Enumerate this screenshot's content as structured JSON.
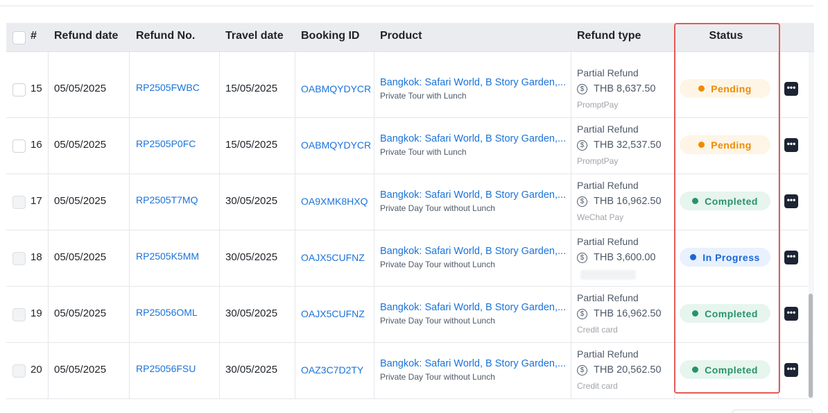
{
  "table": {
    "columns": {
      "index": "#",
      "refund_date": "Refund date",
      "refund_no": "Refund No.",
      "travel_date": "Travel date",
      "booking_id": "Booking ID",
      "product": "Product",
      "refund_type": "Refund type",
      "status": "Status"
    },
    "rows": [
      {
        "index": "15",
        "refund_date": "05/05/2025",
        "refund_no": "RP2505FWBC",
        "travel_date": "15/05/2025",
        "booking_id": "OABMQYDYCR",
        "product_title": "Bangkok: Safari World, B Story Garden,...",
        "product_sub": "Private Tour with Lunch",
        "refund_type": "Partial Refund",
        "amount": "THB 8,637.50",
        "payment": "PromptPay",
        "status": "Pending",
        "status_kind": "pending",
        "checkbox_disabled": false
      },
      {
        "index": "16",
        "refund_date": "05/05/2025",
        "refund_no": "RP2505P0FC",
        "travel_date": "15/05/2025",
        "booking_id": "OABMQYDYCR",
        "product_title": "Bangkok: Safari World, B Story Garden,...",
        "product_sub": "Private Tour with Lunch",
        "refund_type": "Partial Refund",
        "amount": "THB 32,537.50",
        "payment": "PromptPay",
        "status": "Pending",
        "status_kind": "pending",
        "checkbox_disabled": false
      },
      {
        "index": "17",
        "refund_date": "05/05/2025",
        "refund_no": "RP2505T7MQ",
        "travel_date": "30/05/2025",
        "booking_id": "OA9XMK8HXQ",
        "product_title": "Bangkok: Safari World, B Story Garden,...",
        "product_sub": "Private Day Tour without Lunch",
        "refund_type": "Partial Refund",
        "amount": "THB 16,962.50",
        "payment": "WeChat Pay",
        "status": "Completed",
        "status_kind": "completed",
        "checkbox_disabled": true
      },
      {
        "index": "18",
        "refund_date": "05/05/2025",
        "refund_no": "RP2505K5MM",
        "travel_date": "30/05/2025",
        "booking_id": "OAJX5CUFNZ",
        "product_title": "Bangkok: Safari World, B Story Garden,...",
        "product_sub": "Private Day Tour without Lunch",
        "refund_type": "Partial Refund",
        "amount": "THB 3,600.00",
        "payment": "",
        "status": "In Progress",
        "status_kind": "inprogress",
        "checkbox_disabled": true
      },
      {
        "index": "19",
        "refund_date": "05/05/2025",
        "refund_no": "RP25056OML",
        "travel_date": "30/05/2025",
        "booking_id": "OAJX5CUFNZ",
        "product_title": "Bangkok: Safari World, B Story Garden,...",
        "product_sub": "Private Day Tour without Lunch",
        "refund_type": "Partial Refund",
        "amount": "THB 16,962.50",
        "payment": "Credit card",
        "status": "Completed",
        "status_kind": "completed",
        "checkbox_disabled": true
      },
      {
        "index": "20",
        "refund_date": "05/05/2025",
        "refund_no": "RP25056FSU",
        "travel_date": "30/05/2025",
        "booking_id": "OAZ3C7D2TY",
        "product_title": "Bangkok: Safari World, B Story Garden,...",
        "product_sub": "Private Day Tour without Lunch",
        "refund_type": "Partial Refund",
        "amount": "THB 20,562.50",
        "payment": "Credit card",
        "status": "Completed",
        "status_kind": "completed",
        "checkbox_disabled": true
      }
    ]
  },
  "icons": {
    "amount": "dollar-coin-icon",
    "actions": "more-actions-icon"
  },
  "colors": {
    "link": "#1a73d9",
    "pending": "#f08a00",
    "completed": "#27936a",
    "in_progress": "#1a66d6",
    "highlight": "#e45b57"
  }
}
